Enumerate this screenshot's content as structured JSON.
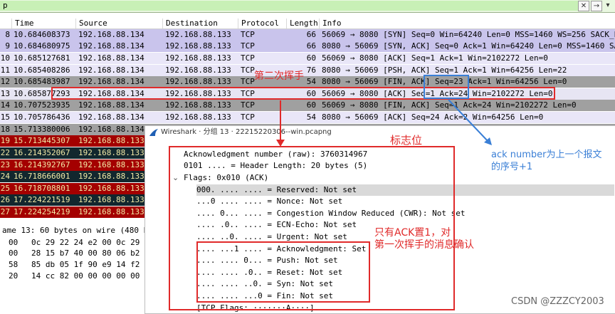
{
  "filter": {
    "value": "p"
  },
  "packet_list": {
    "columns": [
      "Time",
      "Source",
      "Destination",
      "Protocol",
      "Length",
      "Info"
    ],
    "rows": [
      {
        "no": "8",
        "time": "10.684608373",
        "src": "192.168.88.134",
        "dst": "192.168.88.133",
        "proto": "TCP",
        "len": "66",
        "info": "56069 → 8080 [SYN] Seq=0 Win=64240 Len=0 MSS=1460 WS=256 SACK_PE"
      },
      {
        "no": "9",
        "time": "10.684680975",
        "src": "192.168.88.134",
        "dst": "192.168.88.133",
        "proto": "TCP",
        "len": "66",
        "info": "8080 → 56069 [SYN, ACK] Seq=0 Ack=1 Win=64240 Len=0 MSS=1460 SAC"
      },
      {
        "no": "10",
        "time": "10.685127681",
        "src": "192.168.88.134",
        "dst": "192.168.88.133",
        "proto": "TCP",
        "len": "60",
        "info": "56069 → 8080 [ACK] Seq=1 Ack=1 Win=2102272 Len=0"
      },
      {
        "no": "11",
        "time": "10.685408286",
        "src": "192.168.88.134",
        "dst": "192.168.88.133",
        "proto": "TCP",
        "len": "76",
        "info": "8080 → 56069 [PSH, ACK] Seq=1 Ack=1 Win=64256 Len=22"
      },
      {
        "no": "12",
        "time": "10.685483987",
        "src": "192.168.88.134",
        "dst": "192.168.88.133",
        "proto": "TCP",
        "len": "54",
        "info": "8080 → 56069 [FIN, ACK] Seq=23 Ack=1 Win=64256 Len=0"
      },
      {
        "no": "13",
        "time": "10.685877293",
        "src": "192.168.88.134",
        "dst": "192.168.88.133",
        "proto": "TCP",
        "len": "60",
        "info": "56069 → 8080 [ACK] Seq=1 Ack=24 Win=2102272 Len=0"
      },
      {
        "no": "14",
        "time": "10.707523935",
        "src": "192.168.88.134",
        "dst": "192.168.88.133",
        "proto": "TCP",
        "len": "60",
        "info": "56069 → 8080 [FIN, ACK] Seq=1 Ack=24 Win=2102272 Len=0"
      },
      {
        "no": "15",
        "time": "10.705786436",
        "src": "192.168.88.134",
        "dst": "192.168.88.133",
        "proto": "TCP",
        "len": "54",
        "info": "8080 → 56069 [ACK] Seq=24 Ack=2 Win=64256 Len=0"
      },
      {
        "no": "18",
        "time": "15.713380006",
        "src": "192.168.88.134",
        "dst": "",
        "proto": "",
        "len": "",
        "info": ""
      },
      {
        "no": "19",
        "time": "15.713445307",
        "src": "192.168.88.133",
        "dst": "",
        "proto": "",
        "len": "",
        "info": ""
      },
      {
        "no": "22",
        "time": "16.214352067",
        "src": "192.168.88.133",
        "dst": "",
        "proto": "",
        "len": "",
        "info": ""
      },
      {
        "no": "23",
        "time": "16.214392767",
        "src": "192.168.88.133",
        "dst": "",
        "proto": "",
        "len": "",
        "info": ""
      },
      {
        "no": "24",
        "time": "16.718666001",
        "src": "192.168.88.133",
        "dst": "",
        "proto": "",
        "len": "",
        "info": ""
      },
      {
        "no": "25",
        "time": "16.718708801",
        "src": "192.168.88.133",
        "dst": "",
        "proto": "",
        "len": "",
        "info": ""
      },
      {
        "no": "26",
        "time": "17.224221519",
        "src": "192.168.88.133",
        "dst": "",
        "proto": "",
        "len": "",
        "info": ""
      },
      {
        "no": "27",
        "time": "17.224254219",
        "src": "192.168.88.133",
        "dst": "",
        "proto": "",
        "len": "",
        "info": ""
      }
    ]
  },
  "frame_summary": "ame 13: 60 bytes on wire (480 b",
  "hex": [
    {
      "off": "00",
      "bytes": "0c 29 22 24 e2 00 0c  29"
    },
    {
      "off": "00",
      "bytes": "28 15 b7 40 00 80 06  b2"
    },
    {
      "off": "58",
      "bytes": "85 db 05 1f 90 e9 14  f2"
    },
    {
      "off": "20",
      "bytes": "14 cc 82 00 00 00 00  00"
    }
  ],
  "dialog": {
    "title": "Wireshark · 分组 13 · 22215220306--win.pcapng",
    "lines": [
      "Acknowledgment number (raw): 3760314967",
      "0101 .... = Header Length: 20 bytes (5)",
      "Flags: 0x010 (ACK)",
      "000. .... .... = Reserved: Not set",
      "...0 .... .... = Nonce: Not set",
      ".... 0... .... = Congestion Window Reduced (CWR): Not set",
      ".... .0.. .... = ECN-Echo: Not set",
      ".... ..0. .... = Urgent: Not set",
      ".... ...1 .... = Acknowledgment: Set",
      ".... .... 0... = Push: Not set",
      ".... .... .0.. = Reset: Not set",
      ".... .... ..0. = Syn: Not set",
      ".... .... ...0 = Fin: Not set",
      "[TCP Flags: ·······A····]"
    ]
  },
  "annotations": {
    "second_wave": "第二次挥手",
    "flag_bits": "标志位",
    "ack_note_1": "ack number为上一个报文",
    "ack_note_2": "的序号+1",
    "only_ack_1": "只有ACK置1，对",
    "only_ack_2": "第一次挥手的消息确认"
  },
  "watermark": "CSDN @ZZZCY2003",
  "colors": {
    "red_annotation": "#e02a2a",
    "blue_annotation": "#3a7fd6",
    "row_red": "#a40000",
    "row_dark": "#12272e",
    "row_purple": "#c9c4ec"
  }
}
